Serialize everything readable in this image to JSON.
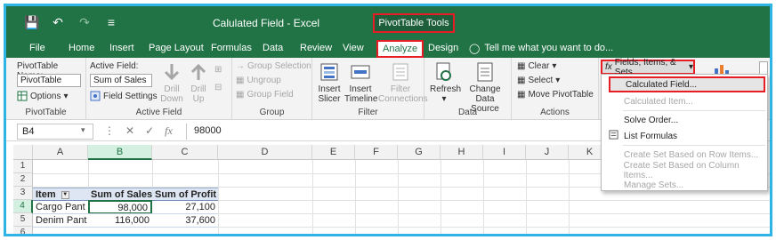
{
  "window": {
    "title": "Calulated Field - Excel",
    "context_group": "PivotTable Tools"
  },
  "tabs": [
    "File",
    "Home",
    "Insert",
    "Page Layout",
    "Formulas",
    "Data",
    "Review",
    "View",
    "Analyze",
    "Design"
  ],
  "active_tab": "Analyze",
  "tell_me": "Tell me what you want to do...",
  "ribbon": {
    "pivottable": {
      "name_label": "PivotTable Name:",
      "name_value": "PivotTable",
      "options_label": "Options",
      "group_label": "PivotTable"
    },
    "active_field": {
      "label": "Active Field:",
      "value": "Sum of Sales",
      "field_settings": "Field Settings",
      "drill_down": [
        "Drill",
        "Down"
      ],
      "drill_up": [
        "Drill",
        "Up"
      ],
      "group_label": "Active Field"
    },
    "group": {
      "group_selection": "Group Selection",
      "ungroup": "Ungroup",
      "group_field": "Group Field",
      "group_label": "Group"
    },
    "filter": {
      "insert_slicer": [
        "Insert",
        "Slicer"
      ],
      "insert_timeline": [
        "Insert",
        "Timeline"
      ],
      "filter_connections": [
        "Filter",
        "Connections"
      ],
      "group_label": "Filter"
    },
    "data": {
      "refresh": "Refresh",
      "change_source": [
        "Change Data",
        "Source"
      ],
      "group_label": "Data"
    },
    "actions": {
      "clear": "Clear",
      "select": "Select",
      "move": "Move PivotTable",
      "group_label": "Actions"
    },
    "calculations": {
      "fields_items_sets": "Fields, Items, & Sets"
    }
  },
  "formula_bar": {
    "name_box": "B4",
    "value": "98000"
  },
  "columns": [
    "A",
    "B",
    "C",
    "D",
    "E",
    "F",
    "G",
    "H",
    "I",
    "J",
    "K"
  ],
  "rows": [
    "1",
    "2",
    "3",
    "4",
    "5",
    "6"
  ],
  "pivot": {
    "headers": [
      "Item",
      "Sum of Sales",
      "Sum of Profit"
    ],
    "rows": [
      [
        "Cargo Pant",
        "98,000",
        "27,100"
      ],
      [
        "Denim Pant",
        "116,000",
        "37,600"
      ]
    ]
  },
  "menu": {
    "items": [
      {
        "label": "Calculated Field...",
        "state": "highlighted"
      },
      {
        "label": "Calculated Item...",
        "state": "disabled"
      },
      {
        "label": "Solve Order...",
        "state": "enabled"
      },
      {
        "label": "List Formulas",
        "state": "enabled"
      },
      {
        "label": "Create Set Based on Row Items...",
        "state": "disabled"
      },
      {
        "label": "Create Set Based on Column Items...",
        "state": "disabled"
      },
      {
        "label": "Manage Sets...",
        "state": "disabled"
      }
    ]
  },
  "colors": {
    "excel_green": "#217346",
    "highlight_red": "#e81c24",
    "frame_blue": "#2fb4e6",
    "pivot_header": "#dde6f2"
  }
}
